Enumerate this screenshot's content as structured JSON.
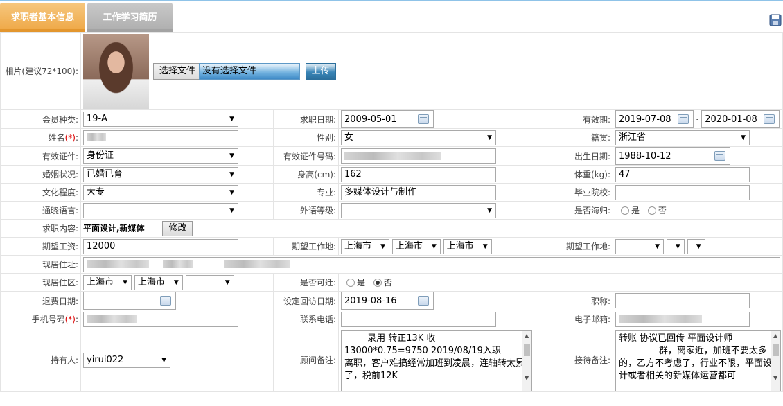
{
  "tabs": {
    "basic_info": "求职者基本信息",
    "work_history": "工作学习简历"
  },
  "photo": {
    "label": "相片(建议72*100):",
    "choose_file": "选择文件",
    "no_file": "没有选择文件",
    "upload": "上传"
  },
  "fields": {
    "member_type": {
      "label": "会员种类:",
      "value": "19-A"
    },
    "job_date": {
      "label": "求职日期:",
      "value": "2009-05-01"
    },
    "valid_period": {
      "label": "有效期:",
      "start": "2019-07-08",
      "sep": "-",
      "end": "2020-01-08"
    },
    "name": {
      "label": "姓名",
      "req": "(*)",
      "colon": ":"
    },
    "gender": {
      "label": "性别:",
      "value": "女"
    },
    "native_place": {
      "label": "籍贯:",
      "value": "浙江省"
    },
    "id_doc": {
      "label": "有效证件:",
      "value": "身份证"
    },
    "id_number": {
      "label": "有效证件号码:"
    },
    "birth_date": {
      "label": "出生日期:",
      "value": "1988-10-12"
    },
    "marital": {
      "label": "婚姻状况:",
      "value": "已婚已育"
    },
    "height": {
      "label": "身高(cm):",
      "value": "162"
    },
    "weight": {
      "label": "体重(kg):",
      "value": "47"
    },
    "education": {
      "label": "文化程度:",
      "value": "大专"
    },
    "major": {
      "label": "专业:",
      "value": "多媒体设计与制作"
    },
    "school": {
      "label": "毕业院校:"
    },
    "language": {
      "label": "通晓语言:",
      "value": ""
    },
    "foreign_level": {
      "label": "外语等级:",
      "value": ""
    },
    "overseas": {
      "label": "是否海归:",
      "yes": "是",
      "no": "否"
    },
    "job_content": {
      "label": "求职内容:",
      "value": "平面设计,新媒体",
      "modify": "修改"
    },
    "salary": {
      "label": "期望工资:",
      "value": "12000"
    },
    "work_place1": {
      "label": "期望工作地:",
      "province": "上海市",
      "city": "上海市",
      "district": "上海市"
    },
    "work_place2": {
      "label": "期望工作地:"
    },
    "address": {
      "label": "现居住址:"
    },
    "district": {
      "label": "现居住区:",
      "province": "上海市",
      "city": "上海市",
      "area": ""
    },
    "relocate": {
      "label": "是否可迁:",
      "yes": "是",
      "no": "否"
    },
    "refund_date": {
      "label": "退费日期:"
    },
    "revisit_date": {
      "label": "设定回访日期:",
      "value": "2019-08-16"
    },
    "title": {
      "label": "职称:"
    },
    "mobile": {
      "label": "手机号码",
      "req": "(*)",
      "colon": ":"
    },
    "phone": {
      "label": "联系电话:"
    },
    "email": {
      "label": "电子邮箱:"
    },
    "holder": {
      "label": "持有人:",
      "value": "yirui022"
    },
    "advisor_note": {
      "label": "顾问备注:",
      "value": "        录用 转正13K 收\n13000*0.75=9750 2019/08/19入职\n离职，客户难搞经常加班到凌晨，连轴转太累了，税前12K"
    },
    "reception_note": {
      "label": "接待备注:",
      "value": "转账 协议已回传 平面设计师\n              群，离家近，加班不要太多的，乙方不考虑了，行业不限，平面设计或者相关的新媒体运营都可"
    }
  }
}
